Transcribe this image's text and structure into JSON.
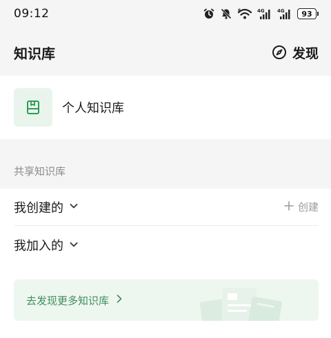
{
  "status_bar": {
    "time": "09:12",
    "battery": "93",
    "icons": [
      "alarm-icon",
      "mute-icon",
      "wifi-icon",
      "signal-4g-icon",
      "signal-4g-icon",
      "battery-icon"
    ],
    "network_label_1": "4G",
    "network_label_2": "4G"
  },
  "header": {
    "title": "知识库",
    "discover_label": "发现",
    "discover_icon": "compass-icon"
  },
  "personal": {
    "label": "个人知识库",
    "icon": "knowledge-book-icon"
  },
  "shared": {
    "section_title": "共享知识库",
    "created_label": "我创建的",
    "joined_label": "我加入的",
    "create_button_label": "创建",
    "banner_label": "去发现更多知识库"
  },
  "colors": {
    "accent_green": "#3f8f5b",
    "icon_green": "#2e9b57",
    "background": "#f5f5f5"
  }
}
